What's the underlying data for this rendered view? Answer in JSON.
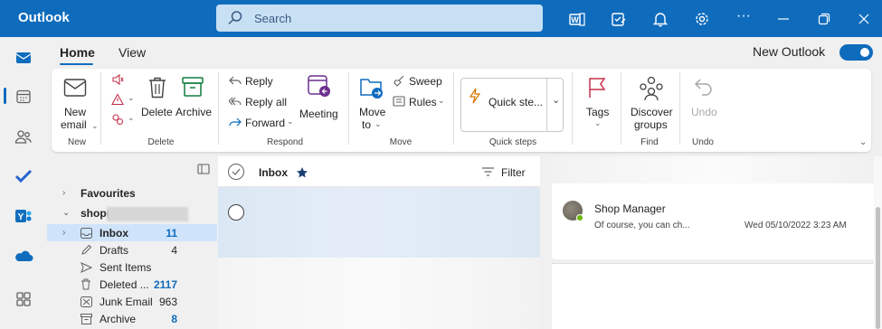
{
  "app": {
    "title": "Outlook"
  },
  "search": {
    "placeholder": "Search"
  },
  "tabs": {
    "home": "Home",
    "view": "View"
  },
  "new_outlook": {
    "label": "New Outlook",
    "enabled": true
  },
  "ribbon": {
    "new_email": [
      "New",
      "email"
    ],
    "new_group": "New",
    "delete": "Delete",
    "archive": "Archive",
    "delete_group": "Delete",
    "reply": "Reply",
    "reply_all": "Reply all",
    "forward": "Forward",
    "meeting": "Meeting",
    "respond_group": "Respond",
    "move_to": [
      "Move",
      "to"
    ],
    "sweep": "Sweep",
    "rules": "Rules",
    "move_group": "Move",
    "quick_steps": "Quick ste...",
    "quick_steps_group": "Quick steps",
    "tags": "Tags",
    "discover_groups": [
      "Discover",
      "groups"
    ],
    "find_group": "Find",
    "undo": "Undo",
    "undo_group": "Undo"
  },
  "folders": {
    "favourites": "Favourites",
    "account": "shop(",
    "items": [
      {
        "name": "Inbox",
        "count": "11",
        "icon": "inbox-icon"
      },
      {
        "name": "Drafts",
        "count": "4",
        "icon": "drafts-icon"
      },
      {
        "name": "Sent Items",
        "count": "",
        "icon": "sent-icon"
      },
      {
        "name": "Deleted ...",
        "count": "2117",
        "icon": "trash-icon"
      },
      {
        "name": "Junk Email",
        "count": "963",
        "icon": "junk-icon"
      },
      {
        "name": "Archive",
        "count": "8",
        "icon": "archive-icon"
      }
    ]
  },
  "message_list": {
    "folder": "Inbox",
    "filter": "Filter"
  },
  "reading": {
    "sender": "Shop Manager",
    "preview": "Of course, you can ch...",
    "date": "Wed 05/10/2022 3:23 AM"
  },
  "colors": {
    "brand": "#0f6cbd",
    "search_bg": "#c7e0f4",
    "selected_folder": "#cfe4fa"
  }
}
